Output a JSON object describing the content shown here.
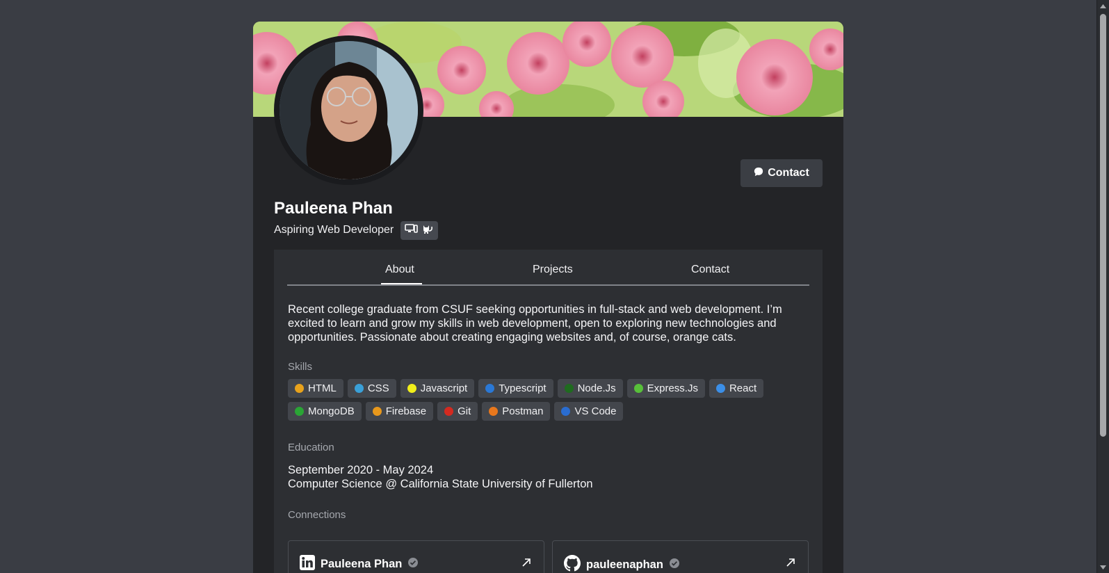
{
  "profile": {
    "name": "Pauleena Phan",
    "subtitle": "Aspiring Web Developer",
    "badge_icons": [
      "computer-icon",
      "cat-icon"
    ]
  },
  "actions": {
    "contact_label": "Contact",
    "contact_icon": "chat-bubble-icon"
  },
  "tabs": [
    {
      "label": "About",
      "active": true
    },
    {
      "label": "Projects",
      "active": false
    },
    {
      "label": "Contact",
      "active": false
    }
  ],
  "about": {
    "text": "Recent college graduate from CSUF seeking opportunities in full-stack and web development. I’m excited to learn and grow my skills in web development, open to exploring new technologies and opportunities. Passionate about creating engaging websites and, of course, orange cats."
  },
  "skills": {
    "label": "Skills",
    "items": [
      {
        "name": "HTML",
        "color": "#e8a21c"
      },
      {
        "name": "CSS",
        "color": "#3aa0d8"
      },
      {
        "name": "Javascript",
        "color": "#f1ee1a"
      },
      {
        "name": "Typescript",
        "color": "#2a78d6"
      },
      {
        "name": "Node.Js",
        "color": "#1f6b1f"
      },
      {
        "name": "Express.Js",
        "color": "#58c03a"
      },
      {
        "name": "React",
        "color": "#3b8fe8"
      },
      {
        "name": "MongoDB",
        "color": "#2aa535"
      },
      {
        "name": "Firebase",
        "color": "#e8981c"
      },
      {
        "name": "Git",
        "color": "#d42a20"
      },
      {
        "name": "Postman",
        "color": "#e8771c"
      },
      {
        "name": "VS Code",
        "color": "#2a6dd1"
      }
    ]
  },
  "education": {
    "label": "Education",
    "dates": "September 2020 - May 2024",
    "school": "Computer Science @ California State University of Fullerton"
  },
  "connections": {
    "label": "Connections",
    "items": [
      {
        "name": "Pauleena Phan",
        "icon": "linkedin-icon"
      },
      {
        "name": "pauleenaphan",
        "icon": "github-icon"
      }
    ]
  },
  "colors": {
    "page_bg": "#3a3d44",
    "card_bg": "#232427",
    "panel_bg": "#2d2f33",
    "chip_bg": "#43464c"
  }
}
